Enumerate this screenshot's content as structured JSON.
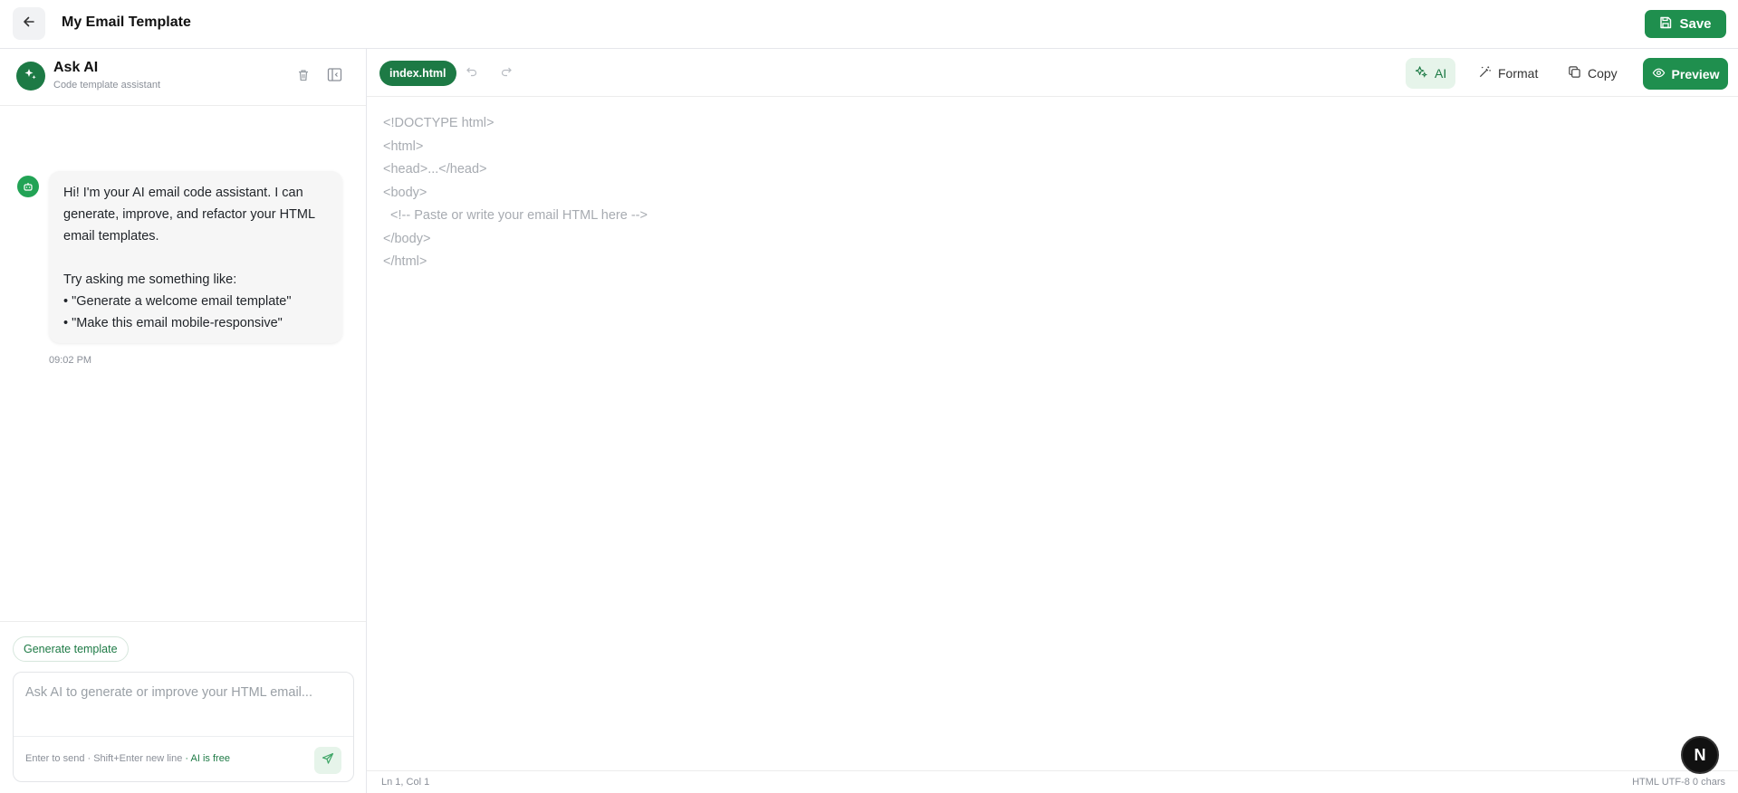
{
  "header": {
    "title": "My Email Template",
    "save_label": "Save"
  },
  "sidebar": {
    "title": "Ask AI",
    "subtitle": "Code template assistant",
    "message": {
      "text": "Hi! I'm your AI email code assistant. I can generate, improve, and refactor your HTML email templates.\n\nTry asking me something like:\n• \"Generate a welcome email template\"\n• \"Make this email mobile-responsive\"",
      "time": "09:02 PM"
    },
    "chip_label": "Generate template",
    "composer": {
      "placeholder": "Ask AI to generate or improve your HTML email...",
      "value": "",
      "hint": "Enter to send · Shift+Enter new line",
      "hint_free": "· AI is free"
    }
  },
  "editor": {
    "file_tab": "index.html",
    "ai_label": "AI",
    "format_label": "Format",
    "copy_label": "Copy",
    "preview_label": "Preview",
    "code_lines": [
      "<!DOCTYPE html>",
      "<html>",
      "<head>...</head>",
      "<body>",
      "  <!-- Paste or write your email HTML here -->",
      "</body>",
      "</html>"
    ],
    "status_left": "Ln 1, Col 1",
    "status_right": "HTML UTF-8 0 chars"
  },
  "badge": {
    "label": "N"
  },
  "colors": {
    "brand_green": "#1f8f4e",
    "light_green": "#e6f4ea"
  }
}
